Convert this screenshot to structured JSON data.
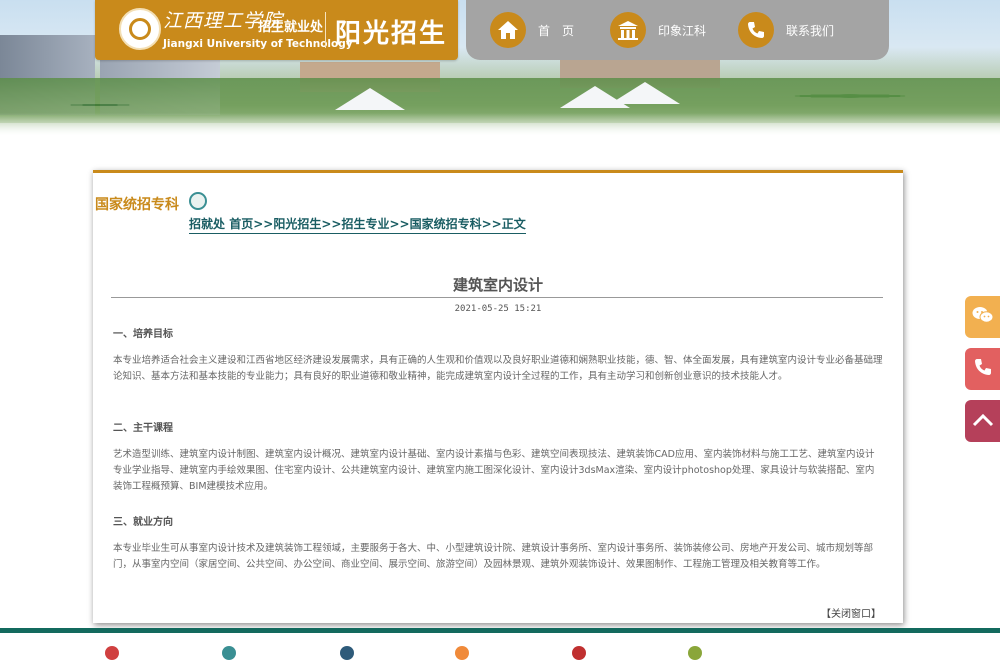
{
  "header": {
    "school_name_calligraphy": "江西理工学院",
    "department": "招生就业处",
    "school_name_en": "Jiangxi University of Technology",
    "slogan": "阳光招生"
  },
  "nav": {
    "items": [
      {
        "label": "首　页",
        "icon": "home-icon"
      },
      {
        "label": "印象江科",
        "icon": "gate-building-icon"
      },
      {
        "label": "联系我们",
        "icon": "phone-icon"
      }
    ]
  },
  "content": {
    "category_title": "国家统招专科",
    "breadcrumb": [
      "招就处",
      "首页",
      ">>",
      "阳光招生",
      ">>",
      "招生专业",
      ">>",
      "国家统招专科",
      ">>",
      "正文"
    ],
    "article_title": "建筑室内设计",
    "date": "2021-05-25 15:21",
    "sections": [
      {
        "heading": "一、培养目标",
        "body": "本专业培养适合社会主义建设和江西省地区经济建设发展需求，具有正确的人生观和价值观以及良好职业道德和娴熟职业技能，德、智、体全面发展，具有建筑室内设计专业必备基础理论知识、基本方法和基本技能的专业能力；具有良好的职业道德和敬业精神，能完成建筑室内设计全过程的工作，具有主动学习和创新创业意识的技术技能人才。"
      },
      {
        "heading": "二、主干课程",
        "body": "艺术造型训练、建筑室内设计制图、建筑室内设计概况、建筑室内设计基础、室内设计素描与色彩、建筑空间表现技法、建筑装饰CAD应用、室内装饰材料与施工工艺、建筑室内设计专业学业指导、建筑室内手绘效果图、住宅室内设计、公共建筑室内设计、建筑室内施工图深化设计、室内设计3dsMax渲染、室内设计photoshop处理、家具设计与软装搭配、室内装饰工程概预算、BIM建模技术应用。"
      },
      {
        "heading": "三、就业方向",
        "body": "本专业毕业生可从事室内设计技术及建筑装饰工程领域，主要服务于各大、中、小型建筑设计院、建筑设计事务所、室内设计事务所、装饰装修公司、房地产开发公司、城市规划等部门，从事室内空间（家居空间、公共空间、办公空间、商业空间、展示空间、旅游空间）及园林景观、建筑外观装饰设计、效果图制作、工程施工管理及相关教育等工作。"
      }
    ],
    "close_label": "【关闭窗口】"
  },
  "float_buttons": [
    {
      "icon": "wechat-icon",
      "color": "#f2b050"
    },
    {
      "icon": "phone-icon",
      "color": "#e26060"
    },
    {
      "icon": "back-to-top-icon",
      "color": "#b5405a"
    }
  ],
  "colors": {
    "accent_gold": "#c98a1b",
    "nav_gray": "#a4a4a4",
    "breadcrumb_teal": "#1a5d63",
    "footer_green": "#136a5e"
  }
}
